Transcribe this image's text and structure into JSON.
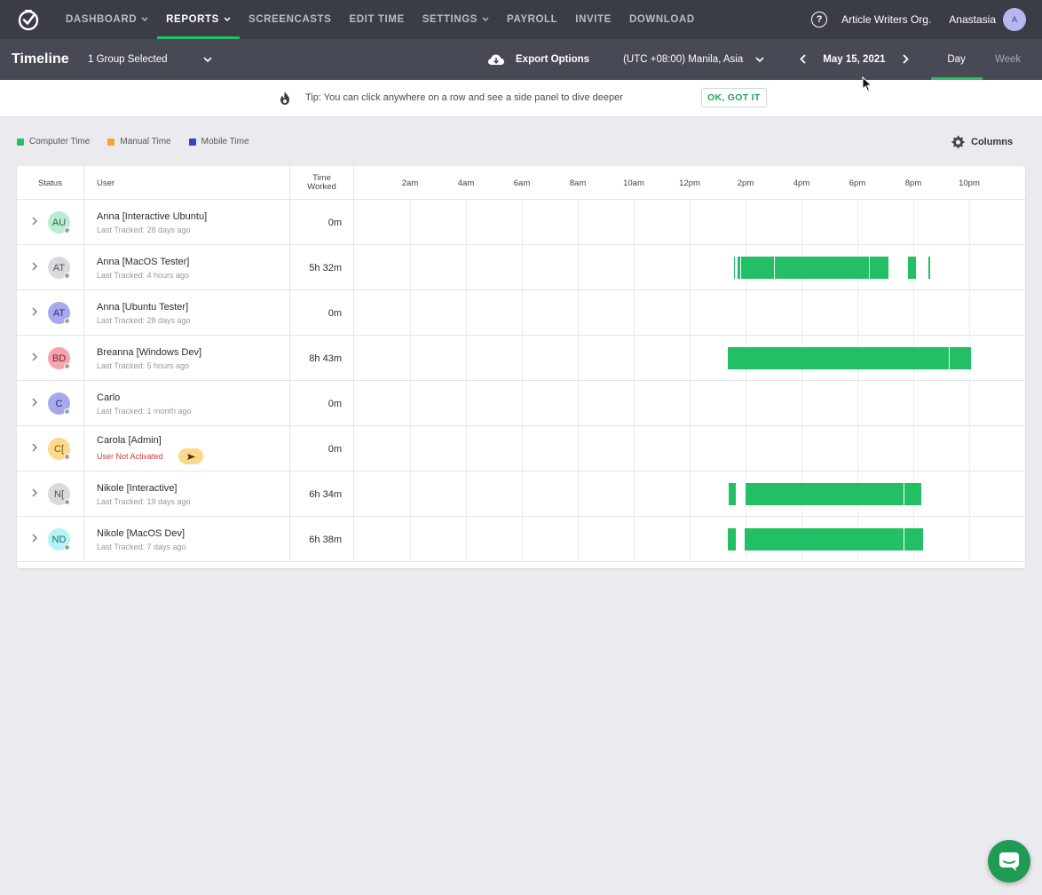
{
  "nav": {
    "items": [
      {
        "label": "DASHBOARD",
        "has_dropdown": true,
        "active": false
      },
      {
        "label": "REPORTS",
        "has_dropdown": true,
        "active": true
      },
      {
        "label": "SCREENCASTS",
        "has_dropdown": false,
        "active": false
      },
      {
        "label": "EDIT TIME",
        "has_dropdown": false,
        "active": false
      },
      {
        "label": "SETTINGS",
        "has_dropdown": true,
        "active": false
      },
      {
        "label": "PAYROLL",
        "has_dropdown": false,
        "active": false
      },
      {
        "label": "INVITE",
        "has_dropdown": false,
        "active": false
      },
      {
        "label": "DOWNLOAD",
        "has_dropdown": false,
        "active": false
      }
    ],
    "org_name": "Article Writers Org.",
    "user_name": "Anastasia",
    "user_initial": "A"
  },
  "subheader": {
    "title": "Timeline",
    "group_select": "1 Group Selected",
    "export_label": "Export Options",
    "timezone": "(UTC +08:00) Manila, Asia",
    "date": "May 15, 2021",
    "view_tabs": [
      {
        "label": "Day",
        "active": true
      },
      {
        "label": "Week",
        "active": false
      }
    ]
  },
  "tip": {
    "text": "Tip: You can click anywhere on a row and see a side panel to dive deeper",
    "button": "OK, GOT IT"
  },
  "legend": [
    {
      "label": "Computer Time",
      "color": "#22bf64"
    },
    {
      "label": "Manual Time",
      "color": "#f4a72d"
    },
    {
      "label": "Mobile Time",
      "color": "#3a3fcf"
    }
  ],
  "columns_label": "Columns",
  "table": {
    "headers": {
      "status": "Status",
      "user": "User",
      "time_worked": "Time\nWorked"
    },
    "hours": [
      "2am",
      "4am",
      "6am",
      "8am",
      "10am",
      "12pm",
      "2pm",
      "4pm",
      "6pm",
      "8pm",
      "10pm"
    ],
    "rows": [
      {
        "initials": "AU",
        "avatar_bg": "#b9ecd0",
        "avatar_fg": "#2c6b48",
        "name": "Anna [Interactive Ubuntu]",
        "sub": "Last Tracked: 28 days ago",
        "sub_warn": false,
        "time": "0m",
        "segments": []
      },
      {
        "initials": "AT",
        "avatar_bg": "#d9dadd",
        "avatar_fg": "#555",
        "name": "Anna [MacOS Tester]",
        "sub": "Last Tracked: 4 hours ago",
        "sub_warn": false,
        "time": "5h 32m",
        "segments": [
          [
            13.58,
            13.62
          ],
          [
            13.72,
            13.8
          ],
          [
            13.85,
            15.02
          ],
          [
            15.05,
            18.4
          ],
          [
            18.45,
            19.1
          ],
          [
            19.8,
            20.1
          ],
          [
            20.55,
            20.6
          ]
        ]
      },
      {
        "initials": "AT",
        "avatar_bg": "#a6a9ee",
        "avatar_fg": "#2e2f7a",
        "name": "Anna [Ubuntu Tester]",
        "sub": "Last Tracked: 28 days ago",
        "sub_warn": false,
        "time": "0m",
        "segments": []
      },
      {
        "initials": "BD",
        "avatar_bg": "#f5a3ad",
        "avatar_fg": "#7a2530",
        "name": "Breanna [Windows Dev]",
        "sub": "Last Tracked: 5 hours ago",
        "sub_warn": false,
        "time": "8h 43m",
        "segments": [
          [
            13.35,
            21.27
          ],
          [
            21.3,
            22.05
          ]
        ]
      },
      {
        "initials": "C",
        "avatar_bg": "#a6a9ee",
        "avatar_fg": "#2e2f7a",
        "name": "Carlo",
        "sub": "Last Tracked: 1 month ago",
        "sub_warn": false,
        "time": "0m",
        "segments": []
      },
      {
        "initials": "C[",
        "avatar_bg": "#fcd98a",
        "avatar_fg": "#7a5a14",
        "name": "Carola [Admin]",
        "sub": "User Not Activated",
        "sub_warn": true,
        "time": "0m",
        "segments": [],
        "has_invite": true
      },
      {
        "initials": "N[",
        "avatar_bg": "#d9dadd",
        "avatar_fg": "#555",
        "name": "Nikole [Interactive]",
        "sub": "Last Tracked: 19 days ago",
        "sub_warn": false,
        "time": "6h 34m",
        "segments": [
          [
            13.4,
            13.65
          ],
          [
            14.0,
            19.65
          ],
          [
            19.68,
            20.3
          ]
        ]
      },
      {
        "initials": "ND",
        "avatar_bg": "#b4f3f6",
        "avatar_fg": "#1f6e72",
        "name": "Nikole [MacOS Dev]",
        "sub": "Last Tracked: 7 days ago",
        "sub_warn": false,
        "time": "6h 38m",
        "segments": [
          [
            13.35,
            13.65
          ],
          [
            13.98,
            19.65
          ],
          [
            19.68,
            20.35
          ]
        ]
      }
    ]
  }
}
